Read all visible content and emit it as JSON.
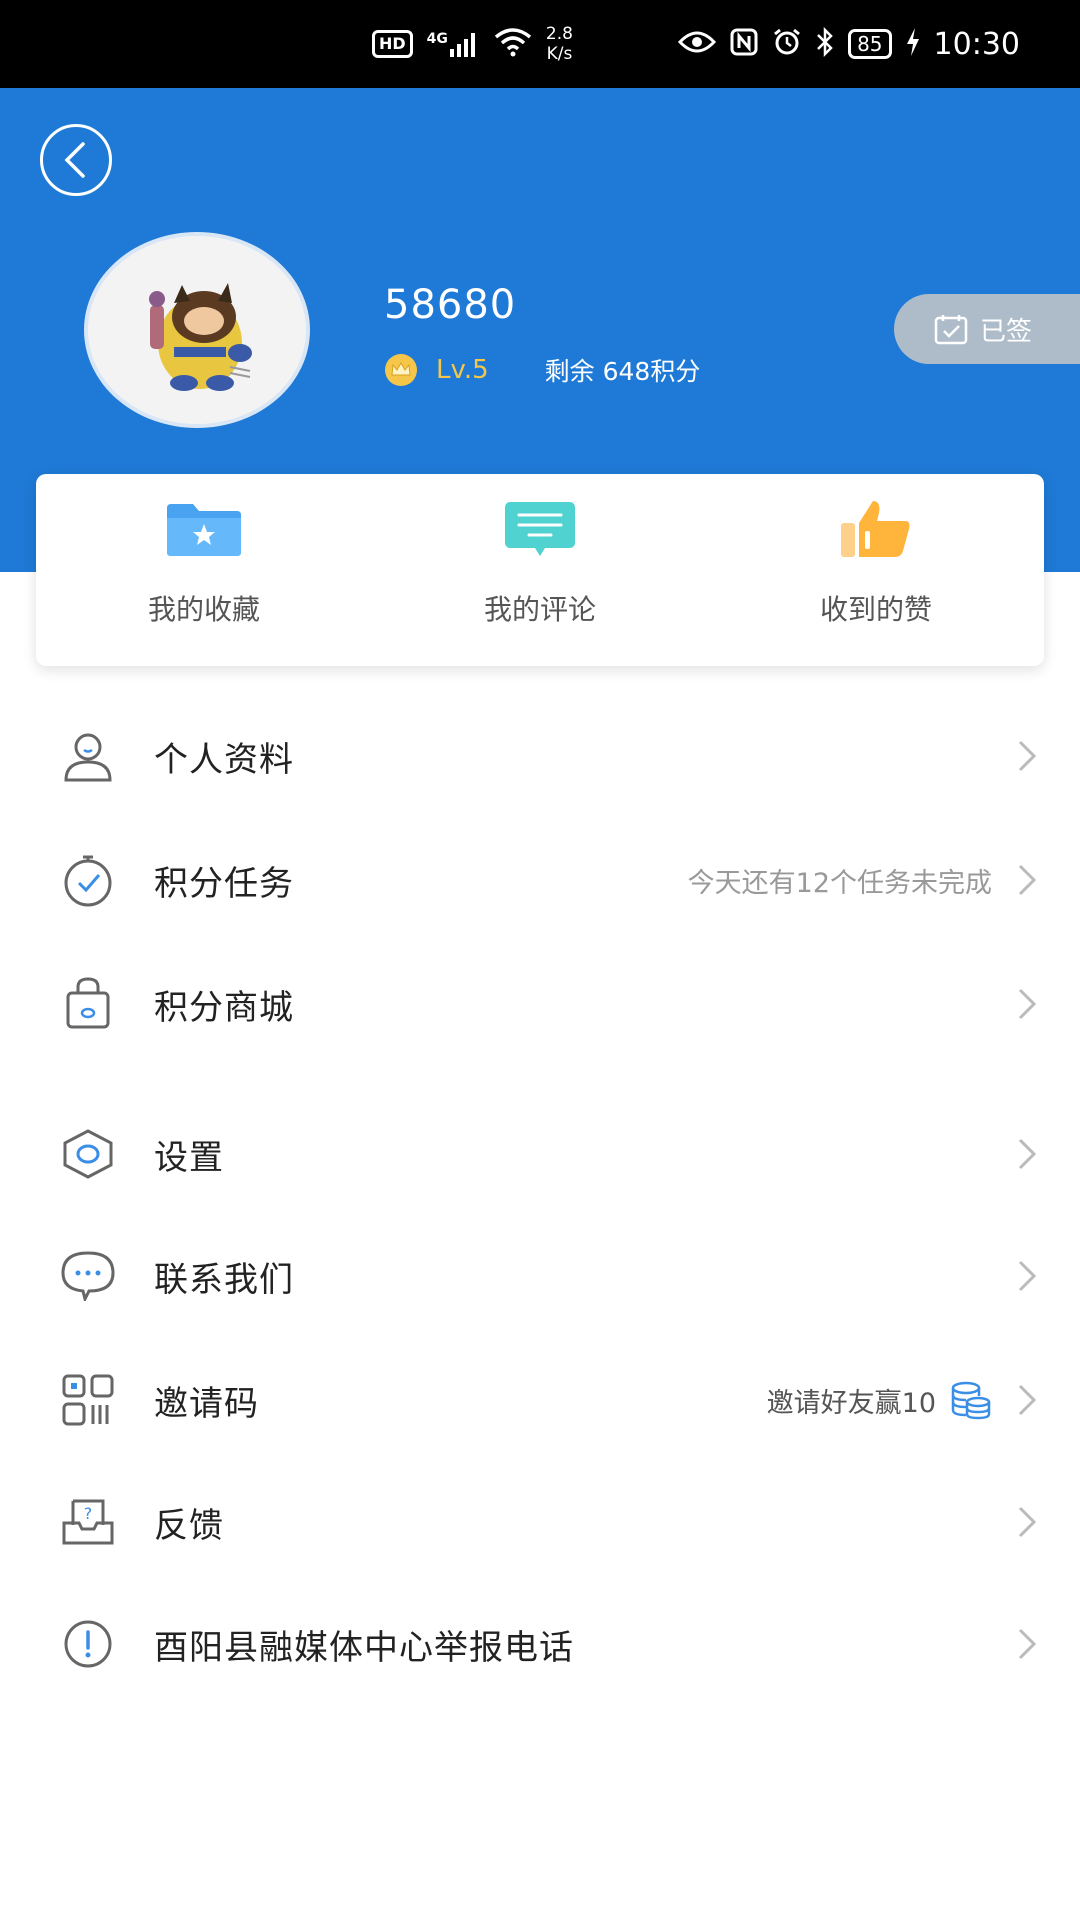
{
  "status_bar": {
    "hd": "HD",
    "signal": "4G",
    "speed_value": "2.8",
    "speed_unit": "K/s",
    "battery": "85",
    "time": "10:30"
  },
  "profile": {
    "username": "58680",
    "level": "Lv.5",
    "points": "剩余 648积分",
    "signed_label": "已签"
  },
  "quick_actions": [
    {
      "label": "我的收藏",
      "icon": "star-folder-icon"
    },
    {
      "label": "我的评论",
      "icon": "comment-icon"
    },
    {
      "label": "收到的赞",
      "icon": "thumbs-up-icon"
    }
  ],
  "menu": [
    {
      "label": "个人资料",
      "icon": "user-icon",
      "hint": ""
    },
    {
      "label": "积分任务",
      "icon": "timer-check-icon",
      "hint": "今天还有12个任务未完成"
    },
    {
      "label": "积分商城",
      "icon": "shopping-bag-icon",
      "hint": ""
    },
    {
      "label": "设置",
      "icon": "hexagon-settings-icon",
      "hint": ""
    },
    {
      "label": "联系我们",
      "icon": "chat-bubble-icon",
      "hint": ""
    },
    {
      "label": "邀请码",
      "icon": "qr-code-icon",
      "hint": "邀请好友赢10",
      "hint_icon": "coins-icon"
    },
    {
      "label": "反馈",
      "icon": "feedback-icon",
      "hint": ""
    },
    {
      "label": "酉阳县融媒体中心举报电话",
      "icon": "exclamation-icon",
      "hint": ""
    }
  ],
  "colors": {
    "header_bg": "#1e7ad6",
    "level_gold": "#f6c64a",
    "icon_gray": "#666666",
    "accent_blue": "#3a8ee6"
  }
}
